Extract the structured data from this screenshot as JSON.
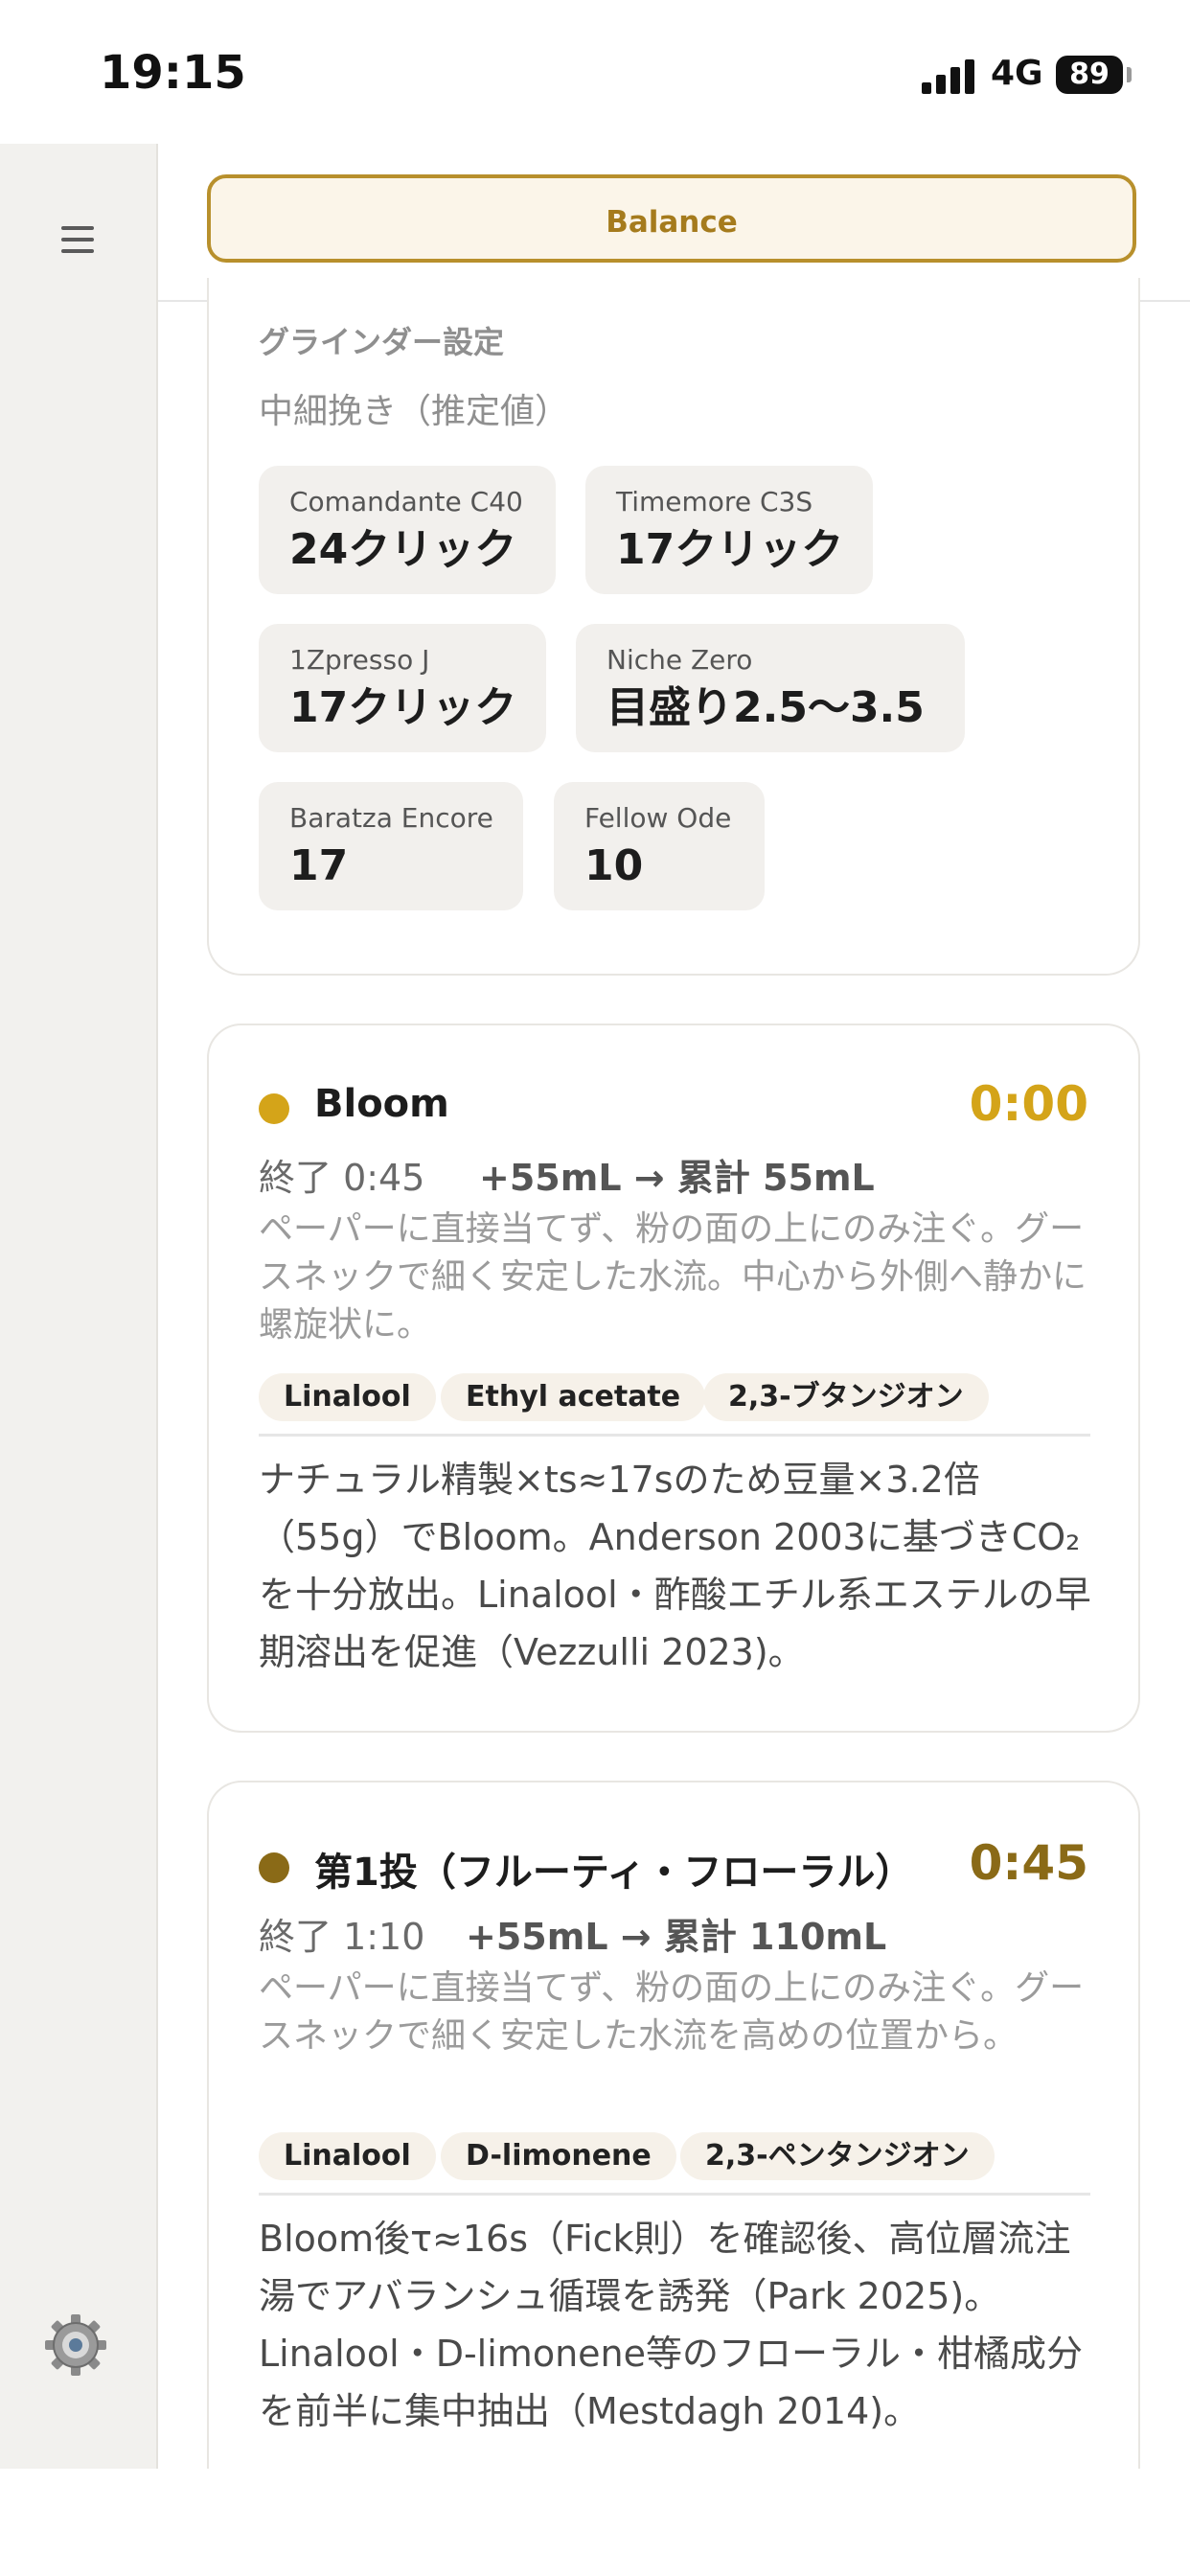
{
  "status": {
    "time": "19:15",
    "network": "4G",
    "battery": "89"
  },
  "header": {
    "balance_label": "Balance"
  },
  "grinder": {
    "title": "グラインダー設定",
    "subtitle": "中細挽き（推定値）",
    "items": [
      {
        "name": "Comandante C40",
        "value": "24クリック"
      },
      {
        "name": "Timemore C3S",
        "value": "17クリック"
      },
      {
        "name": "1Zpresso J",
        "value": "17クリック"
      },
      {
        "name": "Niche Zero",
        "value": "目盛り2.5〜3.5"
      },
      {
        "name": "Baratza Encore",
        "value": "17"
      },
      {
        "name": "Fellow Ode",
        "value": "10"
      }
    ]
  },
  "steps": [
    {
      "title": "Bloom",
      "time": "0:00",
      "end": "終了 0:45",
      "add": "+55mL → 累計 55mL",
      "desc": "ペーパーに直接当てず、粉の面の上にのみ注ぐ。グースネックで細く安定した水流。中心から外側へ静かに螺旋状に。",
      "tags": [
        "Linalool",
        "Ethyl acetate",
        "2,3-ブタンジオン"
      ],
      "note": "ナチュラル精製×ts≈17sのため豆量×3.2倍（55g）でBloom。Anderson 2003に基づきCO₂を十分放出。Linalool・酢酸エチル系エステルの早期溶出を促進（Vezzulli 2023)。",
      "color": "#d4a419"
    },
    {
      "title": "第1投（フルーティ・フローラル）",
      "time": "0:45",
      "end": "終了 1:10",
      "add": "+55mL → 累計 110mL",
      "desc": "ペーパーに直接当てず、粉の面の上にのみ注ぐ。グースネックで細く安定した水流を高めの位置から。",
      "tags": [
        "Linalool",
        "D-limonene",
        "2,3-ペンタンジオン"
      ],
      "note": "Bloom後τ≈16s（Fick則）を確認後、高位層流注湯でアバランシュ循環を誘発（Park 2025)。Linalool・D-limonene等のフローラル・柑橘成分を前半に集中抽出（Mestdagh 2014)。",
      "color": "#8a6a17"
    }
  ],
  "icons": {
    "menu": "menu-icon",
    "settings": "gear-icon"
  }
}
